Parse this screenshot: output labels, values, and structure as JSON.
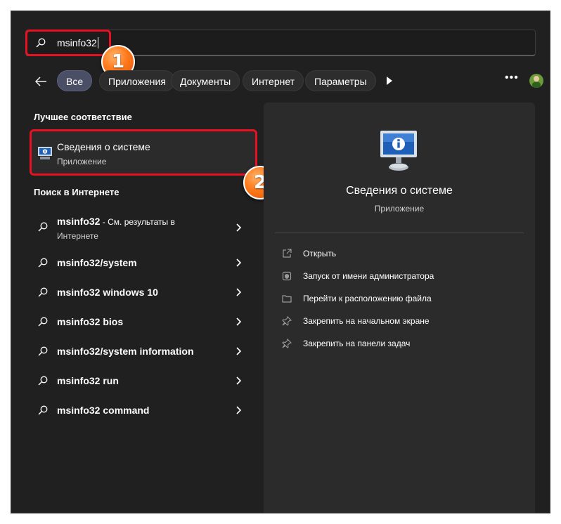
{
  "search": {
    "query": "msinfo32"
  },
  "annotations": {
    "step1": "1",
    "step2": "2"
  },
  "filters": {
    "all": "Все",
    "apps": "Приложения",
    "docs": "Документы",
    "web": "Интернет",
    "settings": "Параметры"
  },
  "best_match": {
    "heading": "Лучшее соответствие",
    "title": "Сведения о системе",
    "subtitle": "Приложение"
  },
  "web_search": {
    "heading": "Поиск в Интернете",
    "first": {
      "query": "msinfo32",
      "suffix": " - См. результаты в",
      "suffix2": "Интернете"
    },
    "items": [
      "msinfo32/system",
      "msinfo32 windows 10",
      "msinfo32 bios",
      "msinfo32/system information",
      "msinfo32 run",
      "msinfo32 command"
    ]
  },
  "detail": {
    "title": "Сведения о системе",
    "subtitle": "Приложение",
    "actions": [
      "Открыть",
      "Запуск от имени администратора",
      "Перейти к расположению файла",
      "Закрепить на начальном экране",
      "Закрепить на панели задач"
    ]
  },
  "colors": {
    "highlight": "#e81123",
    "badge": "#ff7a1a",
    "active_chip": "#4a4f66",
    "background": "#202020"
  }
}
